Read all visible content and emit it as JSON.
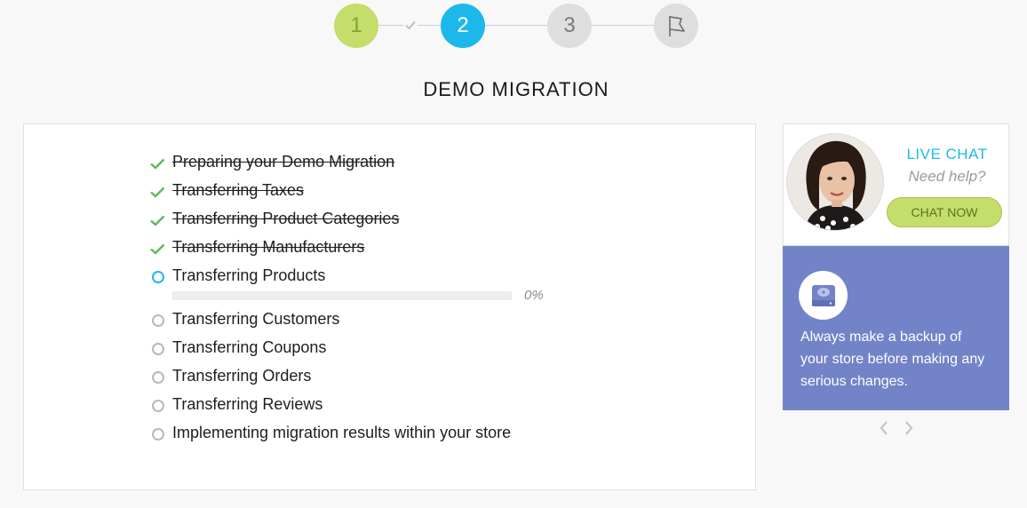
{
  "stepper": {
    "steps": [
      {
        "label": "1",
        "state": "completed"
      },
      {
        "label": "2",
        "state": "current"
      },
      {
        "label": "3",
        "state": "upcoming"
      },
      {
        "label": "",
        "icon": "flag-icon",
        "state": "upcoming"
      }
    ]
  },
  "page": {
    "title": "DEMO MIGRATION"
  },
  "tasks": [
    {
      "label": "Preparing your Demo Migration",
      "status": "done"
    },
    {
      "label": "Transferring Taxes",
      "status": "done"
    },
    {
      "label": "Transferring Product Categories",
      "status": "done"
    },
    {
      "label": "Transferring Manufacturers",
      "status": "done"
    },
    {
      "label": "Transferring Products",
      "status": "active"
    },
    {
      "label": "Transferring Customers",
      "status": "pending"
    },
    {
      "label": "Transferring Coupons",
      "status": "pending"
    },
    {
      "label": "Transferring Orders",
      "status": "pending"
    },
    {
      "label": "Transferring Reviews",
      "status": "pending"
    },
    {
      "label": "Implementing migration results within your store",
      "status": "pending"
    }
  ],
  "progress": {
    "value": 0,
    "label": "0%"
  },
  "chat": {
    "title": "LIVE CHAT",
    "subtitle": "Need help?",
    "button_label": "CHAT NOW"
  },
  "tip": {
    "icon": "hard-drive-icon",
    "text": "Always make a backup of your store before making any serious changes."
  },
  "colors": {
    "accent": "#1cb8ea",
    "green": "#c5dd6a",
    "check": "#5cb85c",
    "tip_bg": "#7383c8"
  }
}
